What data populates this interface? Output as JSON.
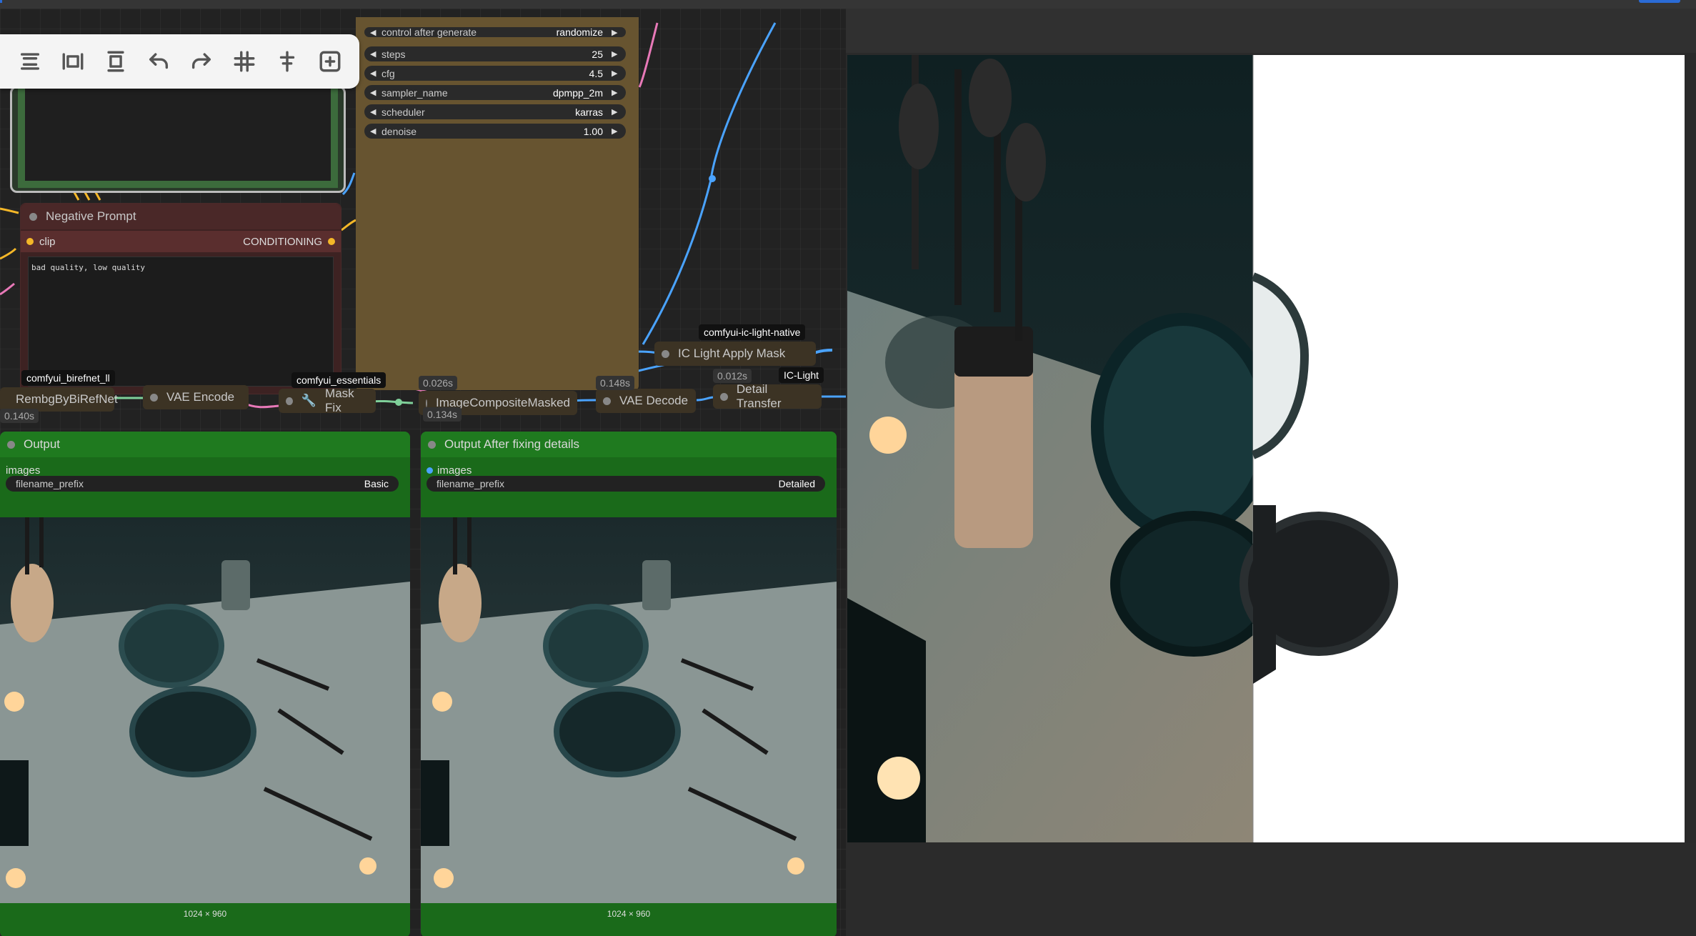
{
  "toolbar": {
    "buttons": [
      "align-left-icon",
      "fit-width-icon",
      "fit-height-icon",
      "undo-icon",
      "redo-icon",
      "grid-icon",
      "align-center-icon",
      "add-node-icon"
    ]
  },
  "ksampler": {
    "widgets": [
      {
        "label": "control after generate",
        "value": "randomize"
      },
      {
        "label": "steps",
        "value": "25"
      },
      {
        "label": "cfg",
        "value": "4.5"
      },
      {
        "label": "sampler_name",
        "value": "dpmpp_2m"
      },
      {
        "label": "scheduler",
        "value": "karras"
      },
      {
        "label": "denoise",
        "value": "1.00"
      }
    ]
  },
  "negative_prompt": {
    "title": "Negative Prompt",
    "input": "clip",
    "output": "CONDITIONING",
    "text": "bad quality, low quality"
  },
  "nodes": {
    "rembg": "RembgByBiRefNet",
    "vae_encode": "VAE Encode",
    "mask_fix": "Mask Fix",
    "image_composite": "ImageCompositeMasked",
    "vae_decode": "VAE Decode",
    "detail_transfer": "Detail Transfer",
    "ic_light_apply": "IC Light Apply Mask"
  },
  "tags": {
    "birefnet": "comfyui_birefnet_ll",
    "essentials": "comfyui_essentials",
    "ic_light_native": "comfyui-ic-light-native",
    "ic_light": "IC-Light"
  },
  "times": {
    "t1": "0.140s",
    "t2": "0.026s",
    "t3": "0.134s",
    "t4": "0.148s",
    "t5": "0.012s"
  },
  "output_basic": {
    "title": "Output",
    "socket": "images",
    "field": "filename_prefix",
    "value": "Basic",
    "dims": "1024 × 960"
  },
  "output_detailed": {
    "title": "Output After fixing details",
    "socket": "images",
    "field": "filename_prefix",
    "value": "Detailed",
    "dims": "1024 × 960"
  },
  "colors": {
    "ksampler": "#675430",
    "negative": "#3d2222",
    "output": "#1a6a1a",
    "wire_blue": "#4aa3ff",
    "wire_pink": "#e879b8",
    "wire_yellow": "#f4b728",
    "wire_green": "#7fd09a"
  }
}
